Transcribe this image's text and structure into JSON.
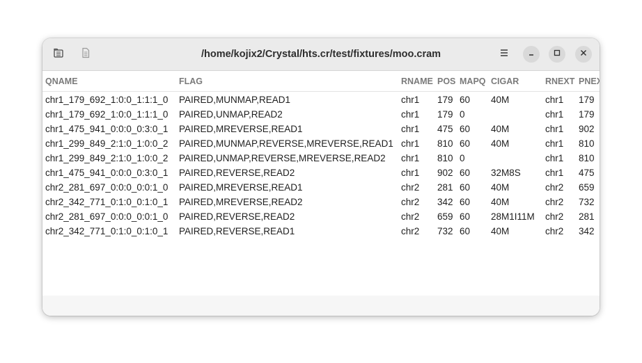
{
  "window": {
    "title": "/home/kojix2/Crystal/hts.cr/test/fixtures/moo.cram"
  },
  "headerbar": {
    "icons": [
      "open-folder-icon",
      "document-icon",
      "hamburger-menu-icon",
      "minimize-icon",
      "maximize-icon",
      "close-icon"
    ]
  },
  "table": {
    "columns": [
      "QNAME",
      "FLAG",
      "RNAME",
      "POS",
      "MAPQ",
      "CIGAR",
      "RNEXT",
      "PNEXT"
    ],
    "rows": [
      [
        "chr1_179_692_1:0:0_1:1:1_0",
        "PAIRED,MUNMAP,READ1",
        "chr1",
        "179",
        "60",
        "40M",
        "chr1",
        "179"
      ],
      [
        "chr1_179_692_1:0:0_1:1:1_0",
        "PAIRED,UNMAP,READ2",
        "chr1",
        "179",
        "0",
        "",
        "chr1",
        "179"
      ],
      [
        "chr1_475_941_0:0:0_0:3:0_1",
        "PAIRED,MREVERSE,READ1",
        "chr1",
        "475",
        "60",
        "40M",
        "chr1",
        "902"
      ],
      [
        "chr1_299_849_2:1:0_1:0:0_2",
        "PAIRED,MUNMAP,REVERSE,MREVERSE,READ1",
        "chr1",
        "810",
        "60",
        "40M",
        "chr1",
        "810"
      ],
      [
        "chr1_299_849_2:1:0_1:0:0_2",
        "PAIRED,UNMAP,REVERSE,MREVERSE,READ2",
        "chr1",
        "810",
        "0",
        "",
        "chr1",
        "810"
      ],
      [
        "chr1_475_941_0:0:0_0:3:0_1",
        "PAIRED,REVERSE,READ2",
        "chr1",
        "902",
        "60",
        "32M8S",
        "chr1",
        "475"
      ],
      [
        "chr2_281_697_0:0:0_0:0:1_0",
        "PAIRED,MREVERSE,READ1",
        "chr2",
        "281",
        "60",
        "40M",
        "chr2",
        "659"
      ],
      [
        "chr2_342_771_0:1:0_0:1:0_1",
        "PAIRED,MREVERSE,READ2",
        "chr2",
        "342",
        "60",
        "40M",
        "chr2",
        "732"
      ],
      [
        "chr2_281_697_0:0:0_0:0:1_0",
        "PAIRED,REVERSE,READ2",
        "chr2",
        "659",
        "60",
        "28M1I11M",
        "chr2",
        "281"
      ],
      [
        "chr2_342_771_0:1:0_0:1:0_1",
        "PAIRED,REVERSE,READ1",
        "chr2",
        "732",
        "60",
        "40M",
        "chr2",
        "342"
      ]
    ]
  }
}
